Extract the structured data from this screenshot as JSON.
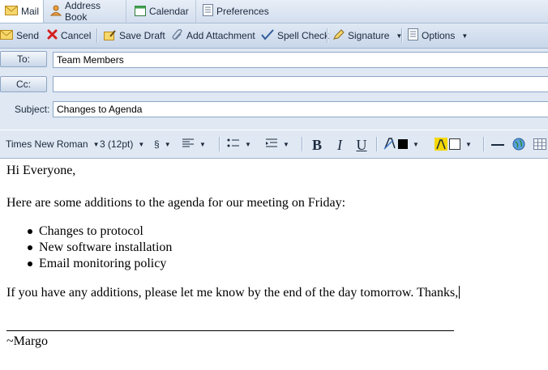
{
  "tabs": {
    "mail": "Mail",
    "address_book": "Address Book",
    "calendar": "Calendar",
    "preferences": "Preferences"
  },
  "toolbar": {
    "send": "Send",
    "cancel": "Cancel",
    "save_draft": "Save Draft",
    "add_attachment": "Add Attachment",
    "spell_check": "Spell Check",
    "signature": "Signature",
    "options": "Options"
  },
  "header": {
    "to_label": "To:",
    "to_value": "Team Members",
    "cc_label": "Cc:",
    "cc_value": "",
    "subject_label": "Subject:",
    "subject_value": "Changes to Agenda"
  },
  "format": {
    "font": "Times New Roman",
    "size": "3 (12pt)",
    "style_symbol": "§"
  },
  "message": {
    "greeting": "Hi Everyone,",
    "intro": "Here are some additions to the agenda for our meeting on Friday:",
    "items": [
      "Changes to protocol",
      "New software installation",
      "Email monitoring policy"
    ],
    "closing": "If you have any additions, please let me know by the end of the day tomorrow. Thanks,",
    "signature": "~Margo"
  },
  "colors": {
    "accent": "#dfe8f3",
    "text_color_swatch": "#000000",
    "highlight_color": "#f5d800"
  }
}
